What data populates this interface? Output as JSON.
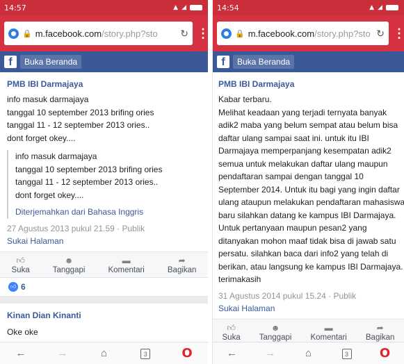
{
  "left": {
    "status": {
      "time": "14:57"
    },
    "url": {
      "host": "m.facebook.com",
      "path": "/story.php?sto"
    },
    "fb": {
      "home_label": "Buka Beranda"
    },
    "post": {
      "author": "PMB IBI Darmajaya",
      "lines": [
        "info masuk darmajaya",
        "tanggal 10 september 2013 brifing ories",
        "tanggal 11 - 12 september 2013 ories..",
        "dont forget okey...."
      ],
      "quote_lines": [
        "info masuk darmajaya",
        "tanggal 10 september 2013 brifing ories",
        "tanggal 11 - 12 september 2013 ories..",
        "dont forget okey...."
      ],
      "translate": "Diterjemahkan dari Bahasa Inggris",
      "meta": "27 Agustus 2013 pukul 21.59 · Publik",
      "like_page": "Sukai Halaman"
    },
    "actions": [
      "Suka",
      "Tanggapi",
      "Komentari",
      "Bagikan"
    ],
    "reaction_count": "6",
    "comment": {
      "author": "Kinan Dian Kinanti",
      "text": "Oke oke"
    }
  },
  "right": {
    "status": {
      "time": "14:54"
    },
    "url": {
      "host": "m.facebook.com",
      "path": "/story.php?sto"
    },
    "fb": {
      "home_label": "Buka Beranda"
    },
    "post": {
      "author": "PMB IBI Darmajaya",
      "lines": [
        "Kabar terbaru.",
        "Melihat keadaan yang terjadi ternyata banyak",
        "adik2 maba yang belum sempat atau belum bisa",
        "daftar ulang sampai saat ini. untuk itu IBI",
        "Darmajaya memperpanjang kesempatan adik2",
        "semua untuk melakukan daftar ulang maupun",
        "pendaftaran sampai dengan tanggal 10",
        "September 2014. Untuk itu bagi yang ingin daftar",
        "ulang ataupun melakukan pendaftaran mahasiswa",
        "baru silahkan datang ke kampus IBI Darmajaya.",
        "Untuk pertanyaan maupun pesan2 yang",
        "ditanyakan mohon maaf tidak bisa di jawab satu",
        "persatu. silahkan baca dari info2 yang telah di",
        "berikan, atau langsung ke kampus IBI Darmajaya.",
        "terimakasih"
      ],
      "meta": "31 Agustus 2014 pukul 15.24 · Publik",
      "like_page": "Sukai Halaman"
    },
    "actions": [
      "Suka",
      "Tanggapi",
      "Komentari",
      "Bagikan"
    ]
  },
  "nav_tab_count": "3",
  "icons": {
    "like": "thumbs-up-icon",
    "react": "smiley-icon",
    "comment": "speech-bubble-icon",
    "share": "share-arrow-icon"
  },
  "colors": {
    "status_red": "#ca2e3a",
    "url_red": "#d63140",
    "fb_blue": "#3b5998",
    "link_blue": "#3b5998"
  }
}
